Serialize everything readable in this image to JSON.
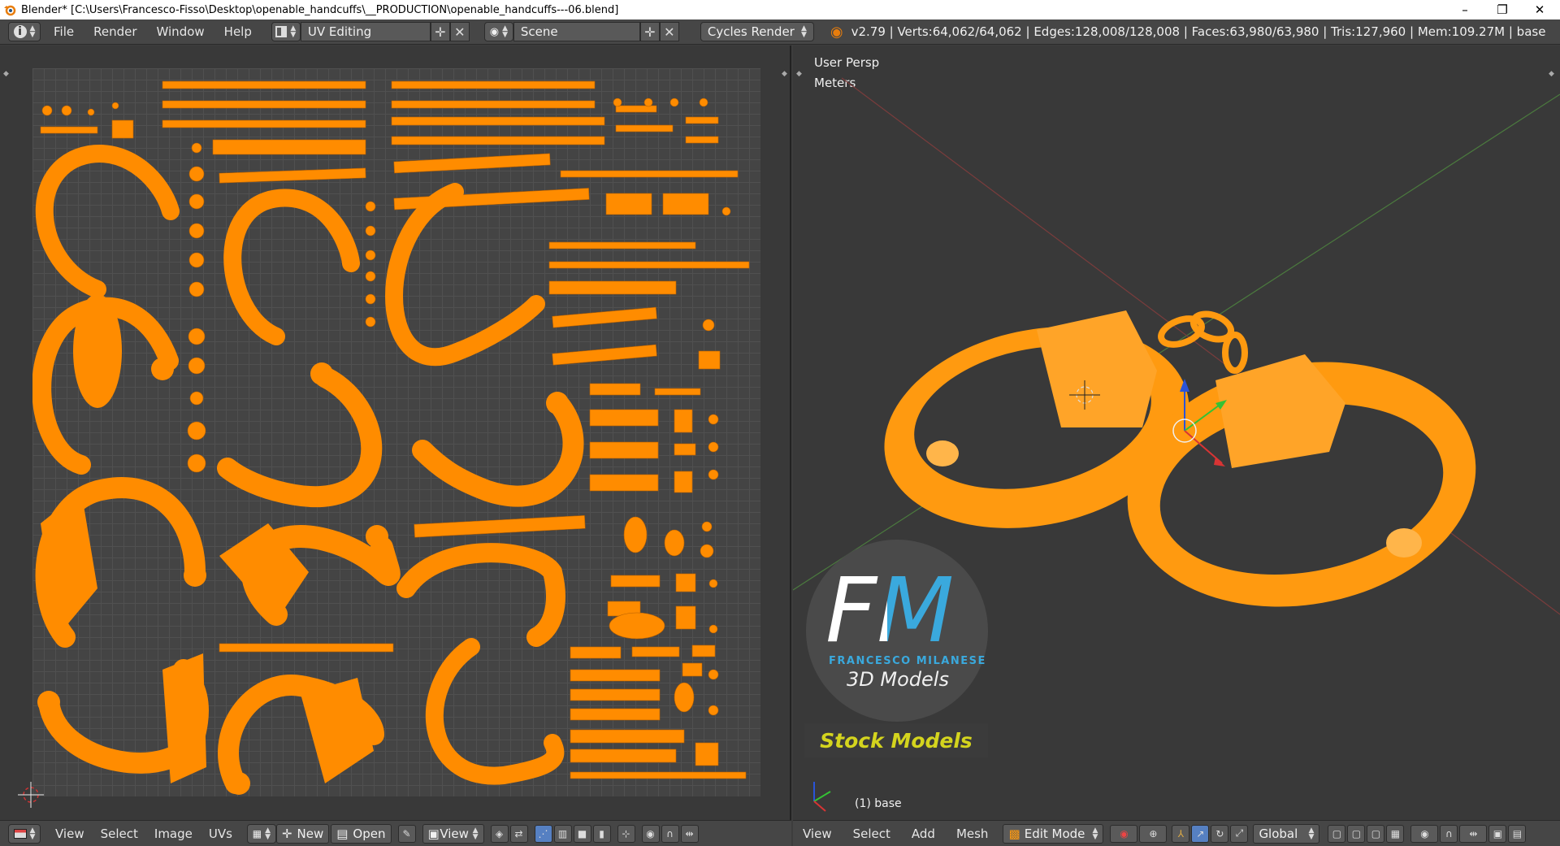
{
  "window": {
    "title": "Blender* [C:\\Users\\Francesco-Fisso\\Desktop\\openable_handcuffs\\__PRODUCTION\\openable_handcuffs---06.blend]",
    "minimize_glyph": "–",
    "restore_glyph": "❐",
    "close_glyph": "✕"
  },
  "top_header": {
    "menus": [
      "File",
      "Render",
      "Window",
      "Help"
    ],
    "screen_layout": "UV Editing",
    "scene": "Scene",
    "render_engine": "Cycles Render",
    "stats": "v2.79 | Verts:64,062/64,062 | Edges:128,008/128,008 | Faces:63,980/63,980 | Tris:127,960 | Mem:109.27M | base"
  },
  "viewport": {
    "view_label": "User Persp",
    "units_label": "Meters",
    "object_label": "(1) base",
    "logo": {
      "letters": "FM",
      "brand": "FRANCESCO MILANESE",
      "subtitle": "3D Models",
      "tag": "Stock Models"
    }
  },
  "uv_header": {
    "menus": [
      "View",
      "Select",
      "Image",
      "UVs"
    ],
    "new_label": "New",
    "open_label": "Open",
    "view_label": "View"
  },
  "view3d_header": {
    "menus": [
      "View",
      "Select",
      "Add",
      "Mesh"
    ],
    "mode": "Edit Mode",
    "orientation": "Global"
  },
  "colors": {
    "accent_orange": "#ff8c00",
    "logo_blue": "#3aa9dd",
    "stock_yellow": "#d4d41e"
  }
}
